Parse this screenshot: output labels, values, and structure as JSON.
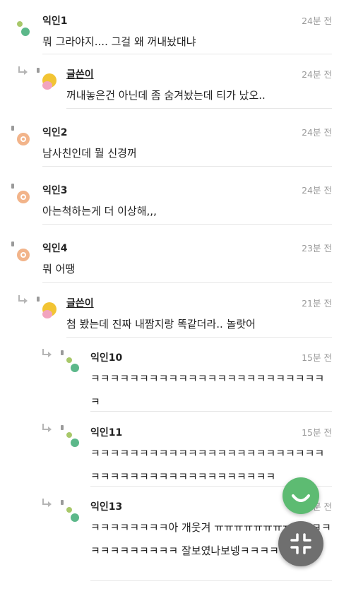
{
  "comments": [
    {
      "author": "익인1",
      "time": "24분 전",
      "text": "뭐 그라야지.... 그걸 왜 꺼내놨대냐"
    },
    {
      "author": "글쓴이",
      "time": "24분 전",
      "text": "꺼내놓은건 아닌데 좀 숨겨놨는데 티가 났오.."
    },
    {
      "author": "익인2",
      "time": "24분 전",
      "text": "남사친인데 뭘 신경꺼"
    },
    {
      "author": "익인3",
      "time": "24분 전",
      "text": "아는척하는게 더 이상해,,,"
    },
    {
      "author": "익인4",
      "time": "23분 전",
      "text": "뭐 어땡"
    },
    {
      "author": "글쓴이",
      "time": "21분 전",
      "text": "첨 봤는데 진짜 내짬지랑 똑같더라.. 놀랏어"
    },
    {
      "author": "익인10",
      "time": "15분 전",
      "text": "ㅋㅋㅋㅋㅋㅋㅋㅋㅋㅋㅋㅋㅋㅋㅋㅋㅋㅋㅋㅋㅋㅋㅋㅋㅋ"
    },
    {
      "author": "익인11",
      "time": "15분 전",
      "text": "ㅋㅋㅋㅋㅋㅋㅋㅋㅋㅋㅋㅋㅋㅋㅋㅋㅋㅋㅋㅋㅋㅋㅋㅋㅋㅋㅋㅋㅋㅋㅋㅋㅋㅋㅋㅋㅋㅋㅋㅋㅋㅋㅋ"
    },
    {
      "author": "익인13",
      "time": "15분 전",
      "text": "ㅋㅋㅋㅋㅋㅋㅋㅋ아 개웃겨 ㅠㅠㅠㅠㅠㅠㅠㅠㅠㅋㅋㅋㅋㅋㅋㅋㅋㅋㅋㅋㅋ 잘보였나보넹ㅋㅋㅋㅋㅋㅋㅠㅠ"
    }
  ],
  "icons": {
    "reply": "reply-arrow-icon",
    "write_comment": "smile-icon",
    "collapse": "collapse-icon"
  },
  "colors": {
    "fab_green": "#5dbb72",
    "fab_gray": "#6f6f6f",
    "time": "#9a9a9a",
    "divider": "#e6e6e6"
  }
}
